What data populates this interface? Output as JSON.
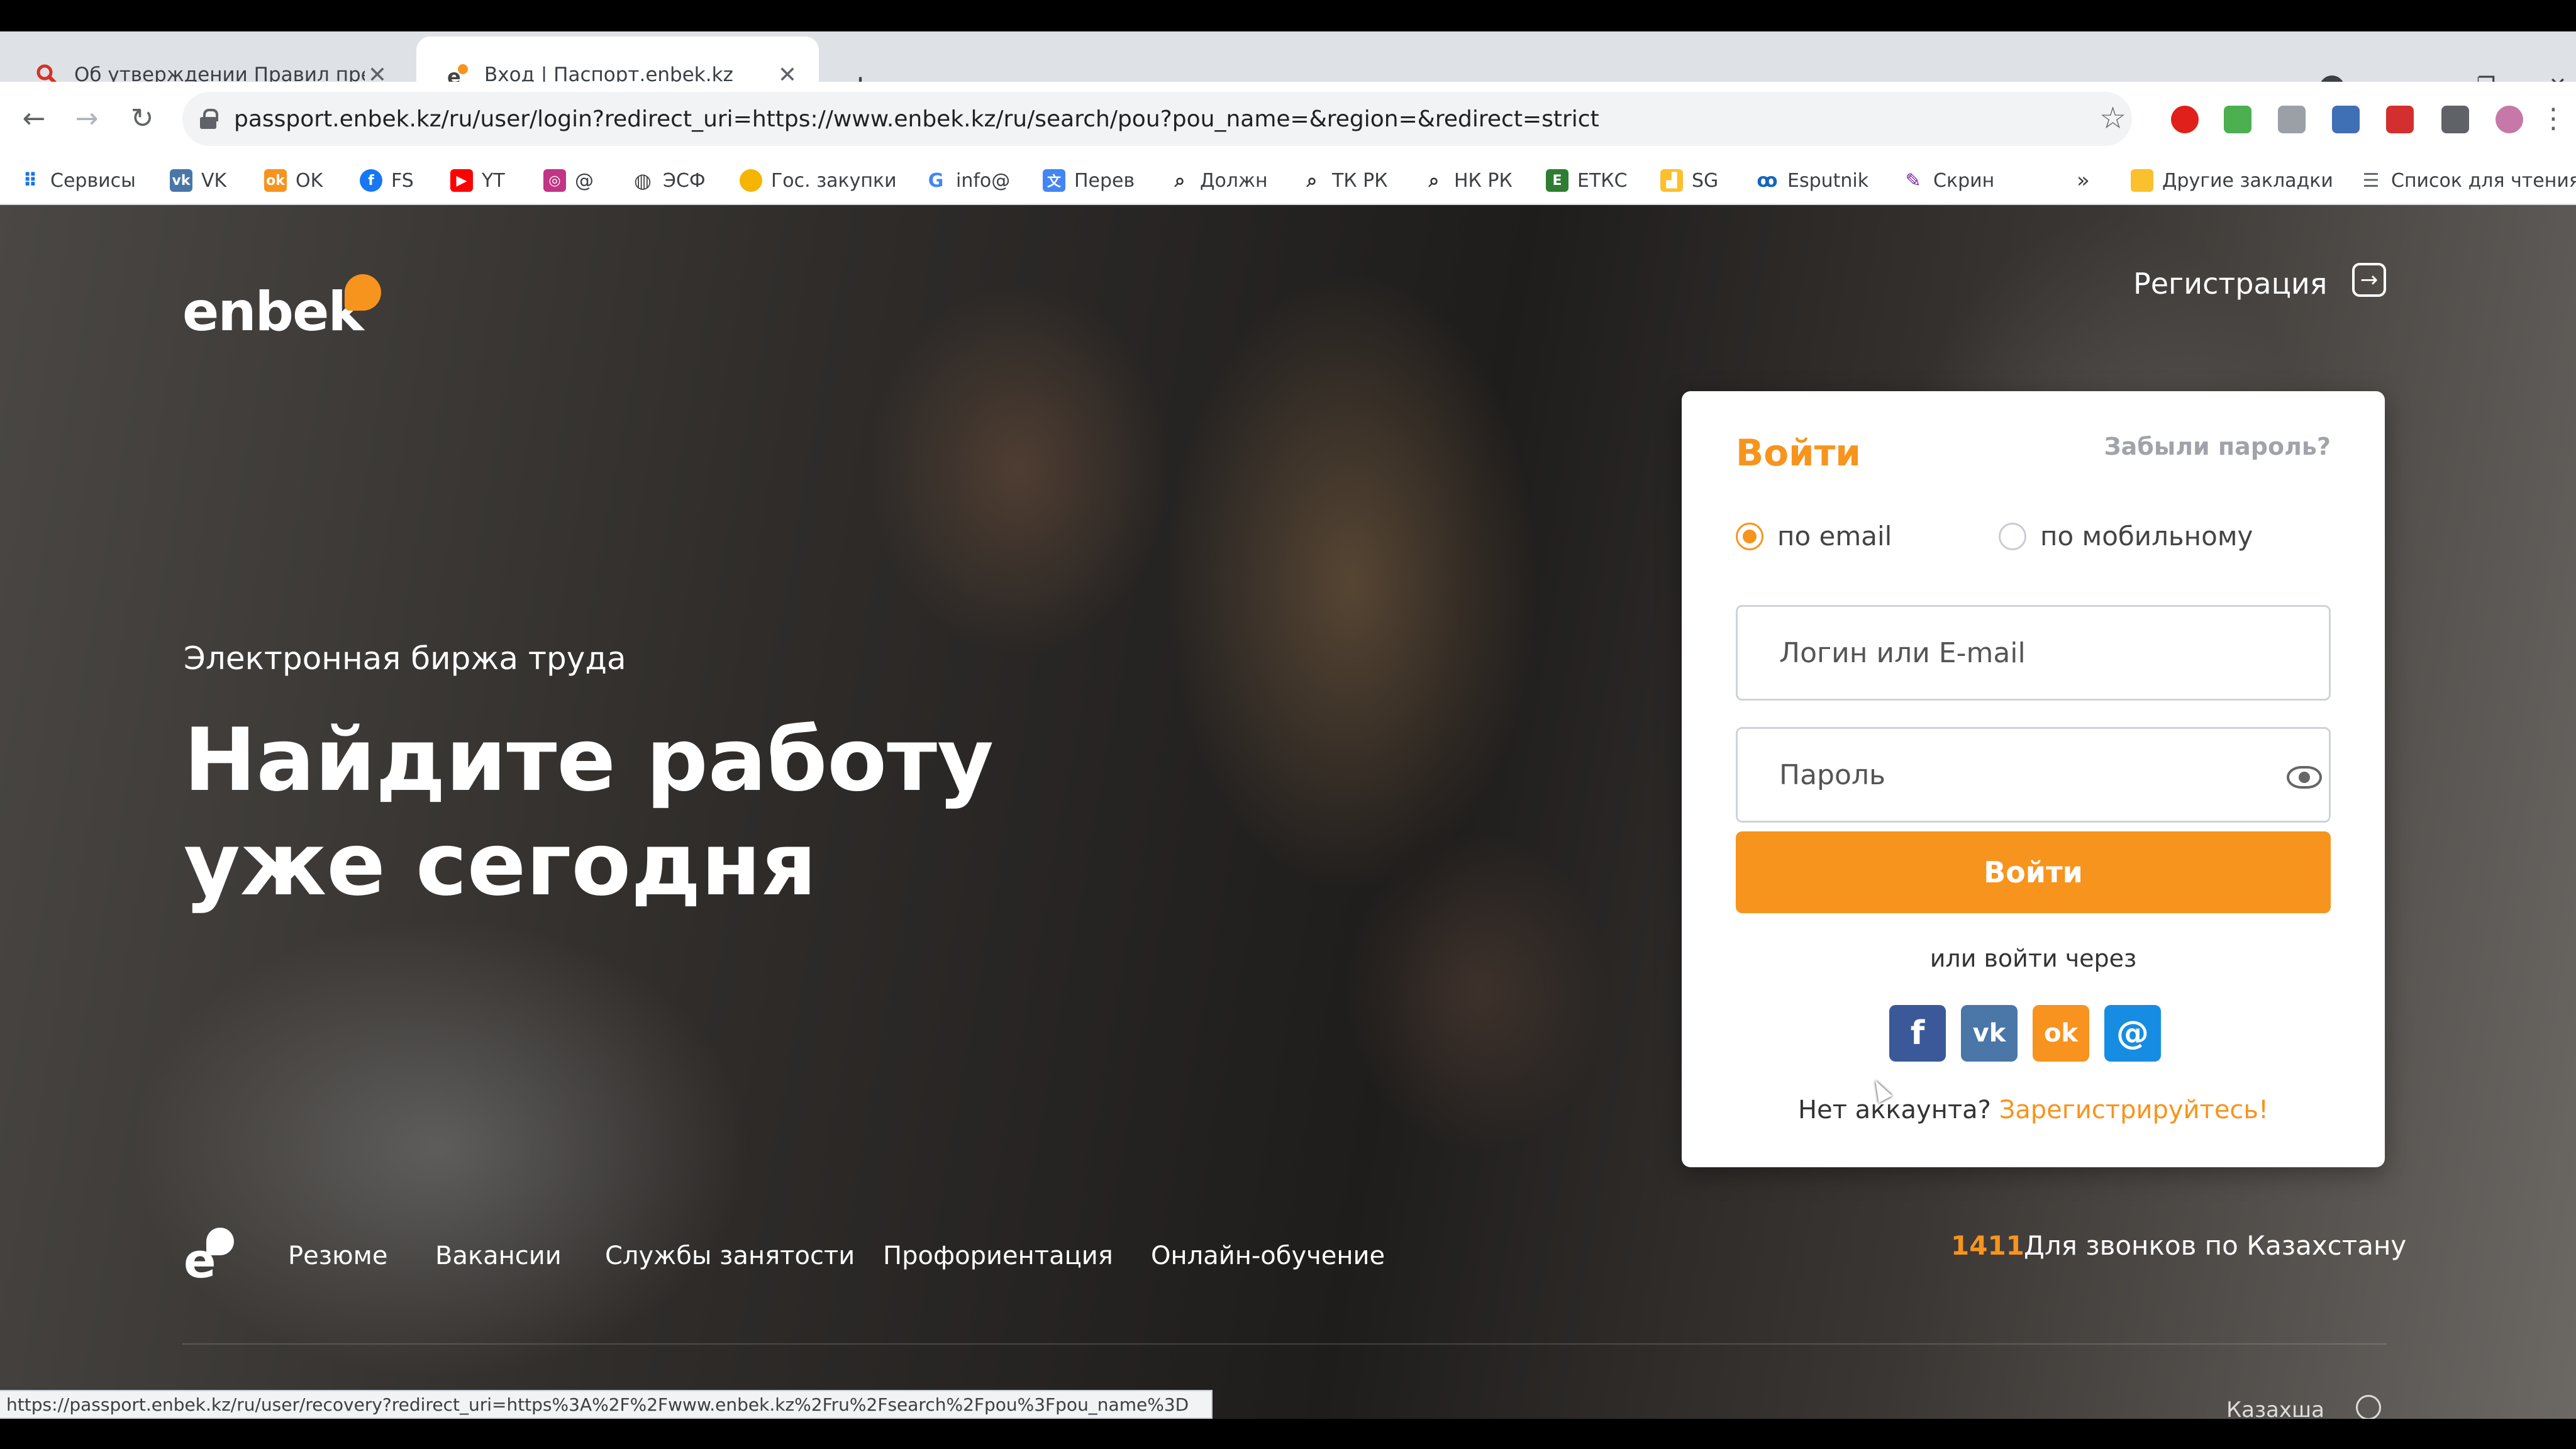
{
  "browser": {
    "tabs": [
      {
        "title": "Об утверждении Правил предо",
        "active": false,
        "icon": "search-icon"
      },
      {
        "title": "Вход | Паспорт.enbek.kz",
        "active": true,
        "icon": "enbek-favicon"
      }
    ],
    "new_tab": "+",
    "window_controls": {
      "minimize": "–",
      "maximize": "❐",
      "close": "✕"
    },
    "url": "passport.enbek.kz/ru/user/login?redirect_uri=https://www.enbek.kz/ru/search/pou?pou_name=&region=&redirect=strict",
    "bookmarks": [
      {
        "label": "Сервисы",
        "icon": "apps-grid-icon"
      },
      {
        "label": "VK",
        "icon": "vk-icon"
      },
      {
        "label": "OK",
        "icon": "ok-icon"
      },
      {
        "label": "FS",
        "icon": "facebook-icon"
      },
      {
        "label": "YT",
        "icon": "youtube-icon"
      },
      {
        "label": "@",
        "icon": "instagram-icon"
      },
      {
        "label": "ЭСФ",
        "icon": "globe-icon"
      },
      {
        "label": "Гос. закупки",
        "icon": "goszakup-icon"
      },
      {
        "label": "info@",
        "icon": "google-icon"
      },
      {
        "label": "Перев",
        "icon": "translate-icon"
      },
      {
        "label": "Должн",
        "icon": "search-icon"
      },
      {
        "label": "ТК РК",
        "icon": "search-icon"
      },
      {
        "label": "НК РК",
        "icon": "search-icon"
      },
      {
        "label": "ЕТКС",
        "icon": "etks-icon"
      },
      {
        "label": "SG",
        "icon": "chart-icon"
      },
      {
        "label": "Esputnik",
        "icon": "esputnik-icon"
      },
      {
        "label": "Скрин",
        "icon": "screenshot-icon"
      }
    ],
    "more": "»",
    "other_bookmarks": "Другие закладки",
    "reading_list": "Список для чтения",
    "status_url": "https://passport.enbek.kz/ru/user/recovery?redirect_uri=https%3A%2F%2Fwww.enbek.kz%2Fru%2Fsearch%2Fpou%3Fpou_name%3D"
  },
  "site": {
    "logo": "enbek",
    "register": "Регистрация",
    "hero_sub": "Электронная биржа труда",
    "hero_title_line1": "Найдите работу",
    "hero_title_line2": "уже сегодня",
    "nav": [
      "Резюме",
      "Вакансии",
      "Службы занятости",
      "Профориентация",
      "Онлайн-обучение"
    ],
    "hotline_number": "1411",
    "hotline_text": "Для звонков по Казахстану",
    "language": "Казахша"
  },
  "login": {
    "title": "Войти",
    "forgot": "Забыли пароль?",
    "radio_email": "по email",
    "radio_mobile": "по мобильному",
    "selected_method": "email",
    "login_placeholder": "Логин или E-mail",
    "password_placeholder": "Пароль",
    "submit": "Войти",
    "or_text": "или войти через",
    "social": [
      {
        "name": "facebook",
        "glyph": "f",
        "color": "#3b5998"
      },
      {
        "name": "vk",
        "glyph": "vk",
        "color": "#4a76a8"
      },
      {
        "name": "ok",
        "glyph": "ok",
        "color": "#f7931e"
      },
      {
        "name": "mailru",
        "glyph": "@",
        "color": "#168de2"
      }
    ],
    "no_account": "Нет аккаунта?",
    "signup": "Зарегистрируйтесь!"
  },
  "colors": {
    "accent": "#f7941d",
    "card_bg": "#ffffff"
  }
}
